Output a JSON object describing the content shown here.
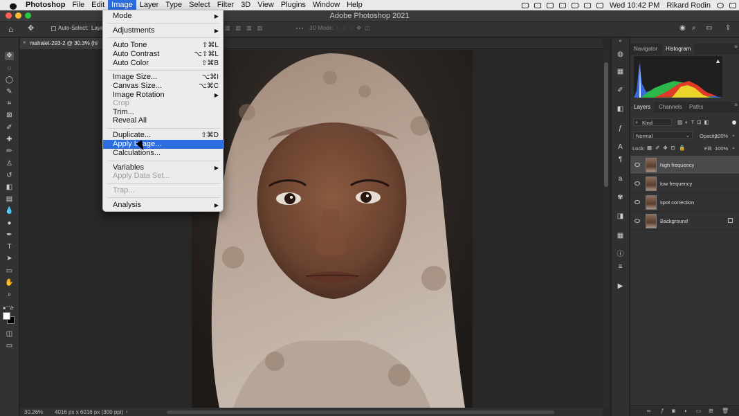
{
  "menubar": {
    "app": "Photoshop",
    "items": [
      "File",
      "Edit",
      "Image",
      "Layer",
      "Type",
      "Select",
      "Filter",
      "3D",
      "View",
      "Plugins",
      "Window",
      "Help"
    ],
    "active": "Image",
    "datetime": "Wed 10:42 PM",
    "user": "Rikard Rodin"
  },
  "window": {
    "title": "Adobe Photoshop 2021"
  },
  "options": {
    "auto_select": "Auto-Select:",
    "layer_mode": "Layer",
    "mode_3d": "3D Mode:"
  },
  "document": {
    "tab_title": "mahalet-293-2 @ 30.3% (hi",
    "zoom": "30.26%",
    "info": "4016 px x 6016 px (300 ppi)"
  },
  "image_menu": {
    "items": [
      {
        "label": "Mode",
        "shortcut": "",
        "submenu": true,
        "disabled": false
      },
      {
        "label": "Adjustments",
        "shortcut": "",
        "submenu": true,
        "disabled": false
      },
      {
        "label": "Auto Tone",
        "shortcut": "⇧⌘L",
        "submenu": false,
        "disabled": false
      },
      {
        "label": "Auto Contrast",
        "shortcut": "⌥⇧⌘L",
        "submenu": false,
        "disabled": false
      },
      {
        "label": "Auto Color",
        "shortcut": "⇧⌘B",
        "submenu": false,
        "disabled": false
      },
      {
        "label": "Image Size...",
        "shortcut": "⌥⌘I",
        "submenu": false,
        "disabled": false
      },
      {
        "label": "Canvas Size...",
        "shortcut": "⌥⌘C",
        "submenu": false,
        "disabled": false
      },
      {
        "label": "Image Rotation",
        "shortcut": "",
        "submenu": true,
        "disabled": false
      },
      {
        "label": "Crop",
        "shortcut": "",
        "submenu": false,
        "disabled": true
      },
      {
        "label": "Trim...",
        "shortcut": "",
        "submenu": false,
        "disabled": false
      },
      {
        "label": "Reveal All",
        "shortcut": "",
        "submenu": false,
        "disabled": false
      },
      {
        "label": "Duplicate...",
        "shortcut": "⇧⌘D",
        "submenu": false,
        "disabled": false
      },
      {
        "label": "Apply Image...",
        "shortcut": "",
        "submenu": false,
        "disabled": false
      },
      {
        "label": "Calculations...",
        "shortcut": "",
        "submenu": false,
        "disabled": false
      },
      {
        "label": "Variables",
        "shortcut": "",
        "submenu": true,
        "disabled": false
      },
      {
        "label": "Apply Data Set...",
        "shortcut": "",
        "submenu": false,
        "disabled": true
      },
      {
        "label": "Trap...",
        "shortcut": "",
        "submenu": false,
        "disabled": true
      },
      {
        "label": "Analysis",
        "shortcut": "",
        "submenu": true,
        "disabled": false
      }
    ],
    "highlighted": "Apply Image..."
  },
  "panels": {
    "top_tabs": [
      "Navigator",
      "Histogram"
    ],
    "layer_tabs": [
      "Layers",
      "Channels",
      "Paths"
    ],
    "filter_kind": "Kind",
    "blend_mode": "Normal",
    "opacity_label": "Opacity:",
    "opacity": "100%",
    "lock_label": "Lock:",
    "fill_label": "Fill:",
    "fill": "100%",
    "layers": [
      {
        "name": "high frequency",
        "selected": true,
        "locked": false
      },
      {
        "name": "low frequency",
        "selected": false,
        "locked": false
      },
      {
        "name": "spot correction",
        "selected": false,
        "locked": false
      },
      {
        "name": "Background",
        "selected": false,
        "locked": true
      }
    ]
  },
  "colors": {
    "menu_highlight": "#2c6de0",
    "traffic_red": "#fe5f57",
    "traffic_yellow": "#febc2e",
    "traffic_green": "#28c840"
  }
}
